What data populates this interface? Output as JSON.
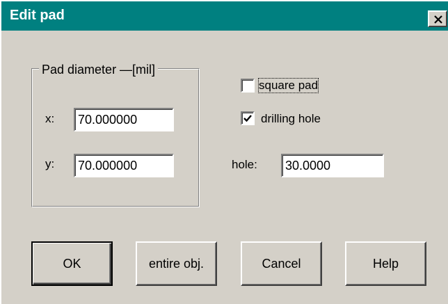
{
  "window": {
    "title": "Edit pad",
    "close_glyph": "close-icon"
  },
  "pad_diameter": {
    "legend": "Pad diameter —[mil]",
    "x_label": "x:",
    "x_value": "70.000000",
    "y_label": "y:",
    "y_value": "70.000000"
  },
  "options": {
    "square_pad_label": "square pad",
    "square_pad_checked": false,
    "drilling_hole_label": "drilling hole",
    "drilling_hole_checked": true,
    "hole_label": "hole:",
    "hole_value": "30.0000"
  },
  "buttons": {
    "ok": "OK",
    "entire_obj": "entire obj.",
    "cancel": "Cancel",
    "help": "Help"
  },
  "colors": {
    "titlebar": "#008080",
    "face": "#d4d0c8"
  }
}
